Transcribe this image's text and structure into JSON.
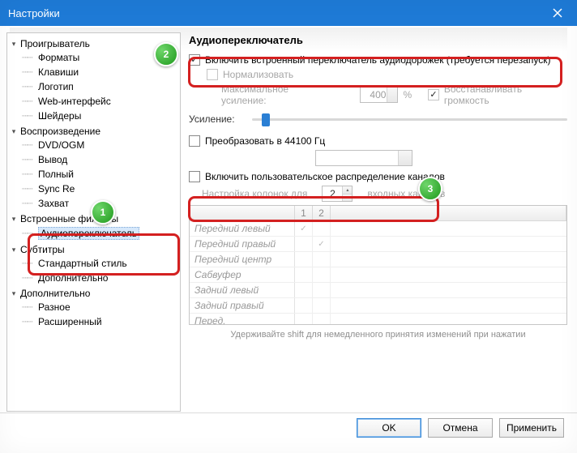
{
  "window": {
    "title": "Настройки"
  },
  "tree": {
    "player": {
      "label": "Проигрыватель",
      "children": {
        "formats": "Форматы",
        "keys": "Клавиши",
        "logo": "Логотип",
        "web": "Web-интерфейс",
        "shaders": "Шейдеры"
      }
    },
    "playback": {
      "label": "Воспроизведение",
      "children": {
        "dvd": "DVD/OGM",
        "output": "Вывод",
        "full": "Полный",
        "sync": "Sync Re",
        "capture": "Захват"
      }
    },
    "internal": {
      "label": "Встроенные фильтры",
      "children": {
        "audio_switcher": "Аудиопереключатель"
      }
    },
    "subs": {
      "label": "Субтитры",
      "children": {
        "std": "Стандартный стиль",
        "adv": "Дополнительно"
      }
    },
    "extra": {
      "label": "Дополнительно",
      "children": {
        "misc": "Разное",
        "ext": "Расширенный"
      }
    }
  },
  "panel": {
    "heading": "Аудиопереключатель",
    "enable_switcher": "Включить встроенный переключатель аудиодорожек (требуется перезапуск)",
    "normalize": "Нормализовать",
    "max_gain_label": "Максимальное усиление:",
    "max_gain_value": "400",
    "percent": "%",
    "restore_volume": "Восстанавливать громкость",
    "gain_label": "Усиление:",
    "convert_44100": "Преобразовать в 44100 Гц",
    "enable_custom_map": "Включить пользовательское распределение каналов",
    "speaker_setup_label": "Настройка колонок для",
    "speaker_count": "2",
    "input_channels": "входных каналов",
    "channels": [
      "Передний левый",
      "Передний правый",
      "Передний центр",
      "Сабвуфер",
      "Задний левый",
      "Задний правый",
      "Перед. центр.левый"
    ],
    "col1": "1",
    "col2": "2",
    "hint": "Удерживайте shift для немедленного принятия изменений при нажатии"
  },
  "buttons": {
    "ok": "OK",
    "cancel": "Отмена",
    "apply": "Применить"
  },
  "badges": {
    "b1": "1",
    "b2": "2",
    "b3": "3"
  }
}
